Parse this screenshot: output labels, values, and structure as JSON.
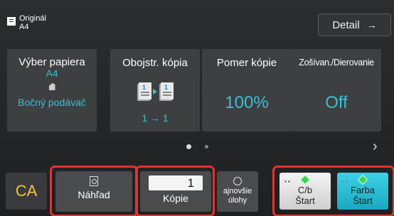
{
  "original": {
    "label": "Originál",
    "value": "A4",
    "icon": "document-icon"
  },
  "header": {
    "detail_label": "Detail",
    "detail_arrow": "→"
  },
  "tiles": {
    "paper": {
      "title": "Výber papiera",
      "size": "A4",
      "source": "Bočný podávač",
      "icon": "tray-icon"
    },
    "duplex": {
      "title": "Obojstr. kópia",
      "mode": "1 → 1",
      "icon": "duplex-icon",
      "left_num": "1",
      "right_num": "1"
    },
    "ratio": {
      "title": "Pomer kópie",
      "value": "100%"
    },
    "staple": {
      "title": "Zošívan./Dierovanie",
      "value": "Off"
    }
  },
  "pager": {
    "next": "›"
  },
  "bottom": {
    "ca_label": "CA",
    "preview_label": "Náhľad",
    "copies_label": "Kópie",
    "copies_value": "1",
    "jobs_label_1": "ajnovšie",
    "jobs_label_2": "úlohy",
    "bw_start_1": "C/b",
    "bw_start_2": "Štart",
    "color_start_1": "Farba",
    "color_start_2": "Štart"
  },
  "colors": {
    "accent": "#39c0d6",
    "highlight": "#e8312e",
    "ca": "#f0c53a",
    "start_green": "#3fd14c"
  }
}
